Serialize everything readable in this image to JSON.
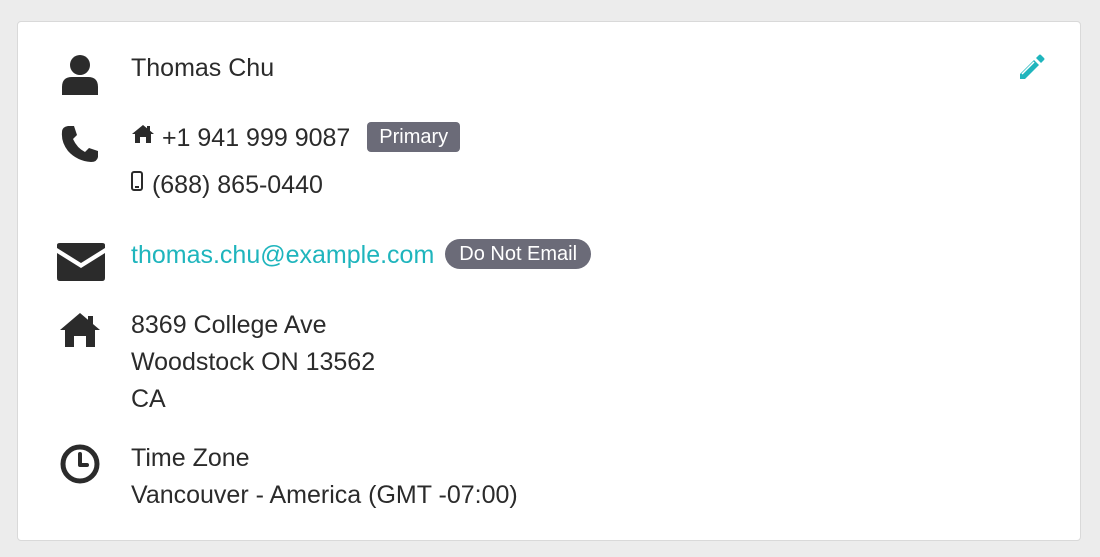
{
  "contact": {
    "name": "Thomas Chu",
    "phones": [
      {
        "number": "+1 941 999 9087",
        "type_icon": "home-icon",
        "badge": "Primary"
      },
      {
        "number": "(688) 865-0440",
        "type_icon": "mobile-phone-icon"
      }
    ],
    "email": {
      "address": "thomas.chu@example.com",
      "badge": "Do Not Email"
    },
    "address": {
      "line1": "8369 College Ave",
      "line2": "Woodstock ON 13562",
      "line3": "CA"
    },
    "timezone": {
      "label": "Time Zone",
      "value": "Vancouver - America (GMT -07:00)"
    }
  },
  "icons": {
    "person": "person-icon",
    "phone": "phone-icon",
    "email": "envelope-icon",
    "address": "house-icon",
    "timezone": "clock-icon",
    "edit": "pencil-icon"
  },
  "colors": {
    "accent": "#1fb5bd",
    "badge_bg": "#6b6b78",
    "icon": "#2b2b2b",
    "text": "#2b2b2b"
  }
}
